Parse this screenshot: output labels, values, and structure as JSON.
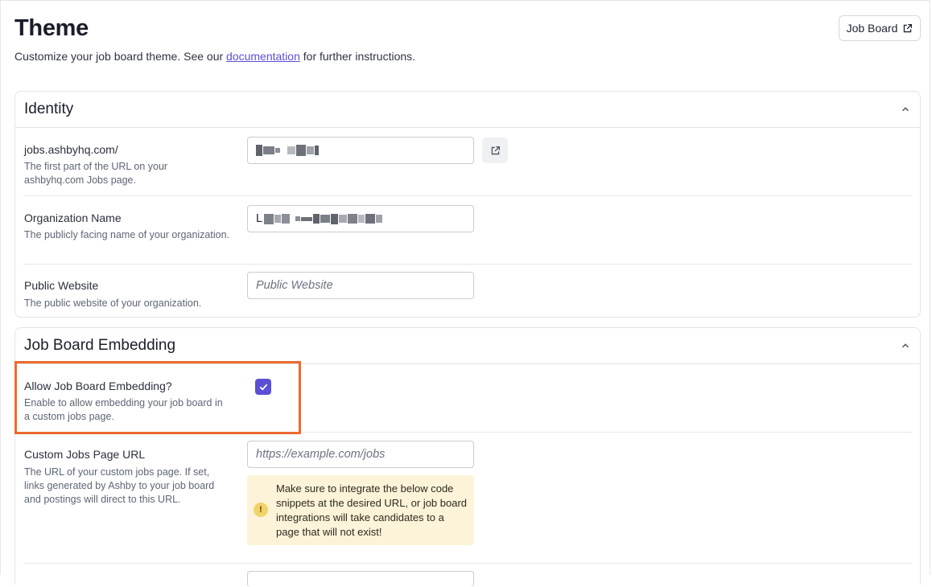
{
  "header": {
    "title": "Theme",
    "subtitle_before": "Customize your job board theme. See our ",
    "subtitle_link": "documentation",
    "subtitle_after": " for further instructions.",
    "job_board_button": "Job Board"
  },
  "identity": {
    "title": "Identity",
    "fields": [
      {
        "label": "jobs.ashbyhq.com/",
        "description": "The first part of the URL on your ashbyhq.com Jobs page.",
        "value": ""
      },
      {
        "label": "Organization Name",
        "description": "The publicly facing name of your organization.",
        "value": "L"
      },
      {
        "label": "Public Website",
        "description": "The public website of your organization.",
        "placeholder": "Public Website"
      }
    ]
  },
  "embedding": {
    "title": "Job Board Embedding",
    "allow": {
      "label": "Allow Job Board Embedding?",
      "description": "Enable to allow embedding your job board in a custom jobs page.",
      "checked": true
    },
    "custom_url": {
      "label": "Custom Jobs Page URL",
      "description": "The URL of your custom jobs page. If set, links generated by Ashby to your job board and postings will direct to this URL.",
      "placeholder": "https://example.com/jobs",
      "warning": "Make sure to integrate the below code snippets at the desired URL, or job board integrations will take candidates to a page that will not exist!"
    }
  },
  "colors": {
    "accent": "#5b4fd6",
    "highlight": "#ec6a2b",
    "warning_bg": "#fcf3d8"
  },
  "icons": [
    "external-link-icon",
    "chevron-up-icon",
    "check-icon",
    "warning-icon"
  ]
}
